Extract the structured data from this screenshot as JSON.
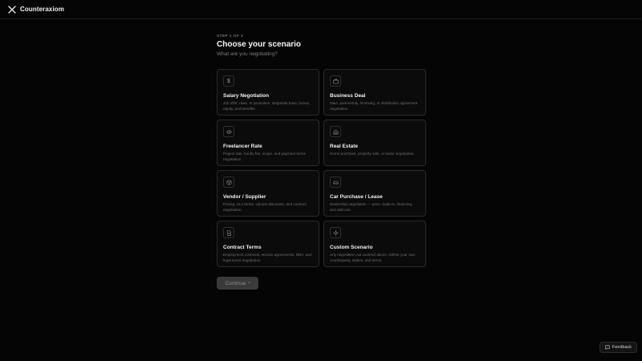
{
  "app": {
    "name": "Counteraxiom"
  },
  "wizard": {
    "step_label": "STEP 1 OF 3",
    "title": "Choose your scenario",
    "subtitle": "What are you negotiating?"
  },
  "scenarios": [
    {
      "icon": "dollar-icon",
      "glyph": "$",
      "title": "Salary Negotiation",
      "description": "Job offer, raise, or promotion. Negotiate base, bonus, equity, and benefits."
    },
    {
      "icon": "briefcase-icon",
      "glyph": "",
      "title": "Business Deal",
      "description": "M&A, partnership, licensing, or distribution agreement negotiation."
    },
    {
      "icon": "code-icon",
      "glyph": "</>",
      "title": "Freelancer Rate",
      "description": "Project rate, hourly fee, scope, and payment terms negotiation."
    },
    {
      "icon": "house-icon",
      "glyph": "",
      "title": "Real Estate",
      "description": "Home purchase, property sale, or lease negotiation."
    },
    {
      "icon": "package-icon",
      "glyph": "",
      "title": "Vendor / Supplier",
      "description": "Pricing, SLA terms, volume discounts, and contract negotiation."
    },
    {
      "icon": "car-icon",
      "glyph": "",
      "title": "Car Purchase / Lease",
      "description": "Dealership negotiation — price, trade-in, financing, and add-ons."
    },
    {
      "icon": "document-icon",
      "glyph": "",
      "title": "Contract Terms",
      "description": "Employment contracts, service agreements, NDA, and legal terms negotiation."
    },
    {
      "icon": "sparkle-icon",
      "glyph": "",
      "title": "Custom Scenario",
      "description": "Any negotiation not covered above. Define your own counterparty, stakes, and terms."
    }
  ],
  "actions": {
    "continue_label": "Continue",
    "continue_arrow": "›"
  },
  "feedback": {
    "label": "Feedback"
  }
}
